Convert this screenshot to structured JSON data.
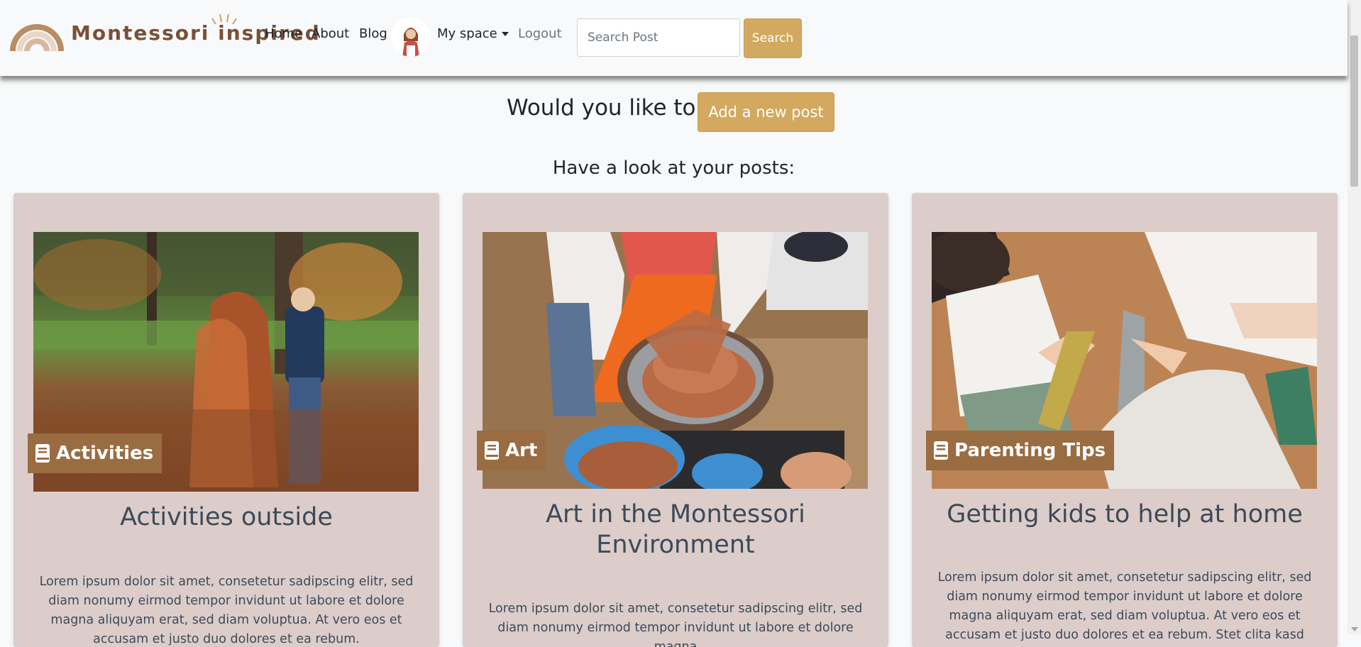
{
  "brand": {
    "name": "Montessori inspired"
  },
  "nav": {
    "home": "Home",
    "about": "About",
    "blog": "Blog",
    "my_space": "My space",
    "logout": "Logout"
  },
  "search": {
    "placeholder": "Search Post",
    "button": "Search"
  },
  "intro": {
    "question": "Would you like to",
    "add_button": "Add a new post",
    "look": "Have a look at your posts:"
  },
  "posts": [
    {
      "category": "Activities",
      "title": "Activities outside",
      "excerpt": "Lorem ipsum dolor sit amet, consetetur sadipscing elitr, sed diam nonumy eirmod tempor invidunt ut labore et dolore magna aliquyam erat, sed diam voluptua. At vero eos et accusam et justo duo dolores et ea rebum."
    },
    {
      "category": "Art",
      "title": "Art in the Montessori Environment",
      "excerpt": "Lorem ipsum dolor sit amet, consetetur sadipscing elitr, sed diam nonumy eirmod tempor invidunt ut labore et dolore magna"
    },
    {
      "category": "Parenting Tips",
      "title": "Getting kids to help at home",
      "excerpt": "Lorem ipsum dolor sit amet, consetetur sadipscing elitr, sed diam nonumy eirmod tempor invidunt ut labore et dolore magna aliquyam erat, sed diam voluptua. At vero eos et accusam et justo duo dolores et ea rebum. Stet clita kasd gubergren, no sea"
    }
  ],
  "colors": {
    "accent": "#d2a95f",
    "badge": "#9a6c41",
    "card": "#dccdcb",
    "title": "#3d4a57",
    "brand": "#7b5036"
  }
}
